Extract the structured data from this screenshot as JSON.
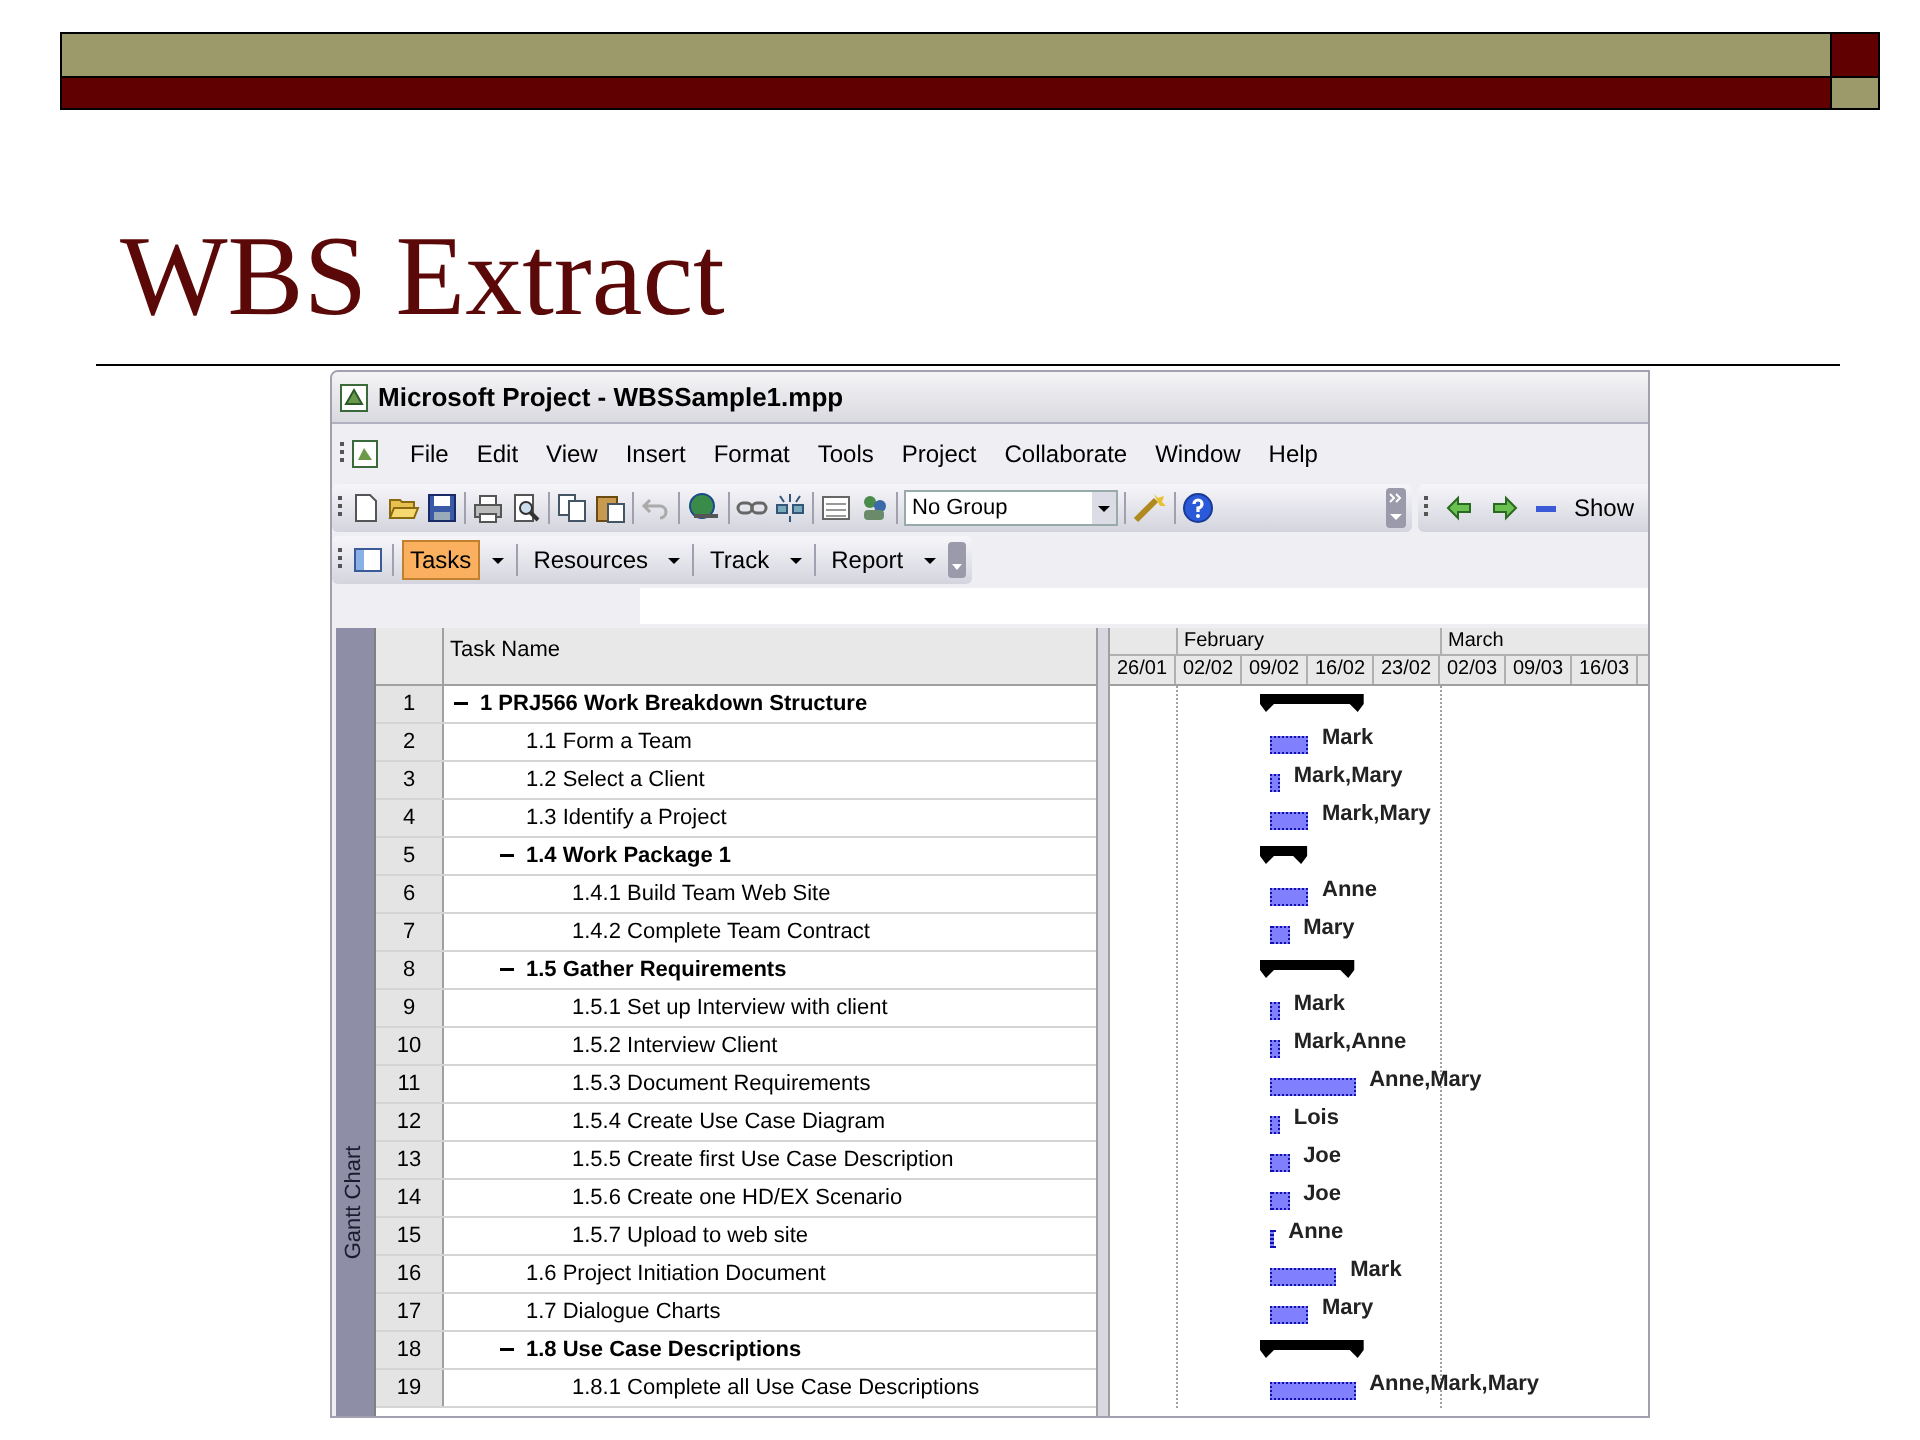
{
  "slide": {
    "title": "WBS Extract"
  },
  "window": {
    "title": "Microsoft Project - WBSSample1.mpp"
  },
  "menu": [
    "File",
    "Edit",
    "View",
    "Insert",
    "Format",
    "Tools",
    "Project",
    "Collaborate",
    "Window",
    "Help"
  ],
  "toolbar": {
    "group_select": "No Group",
    "show_button": "Show"
  },
  "guide_toolbar": [
    {
      "label": "Tasks",
      "selected": true
    },
    {
      "label": "Resources",
      "selected": false
    },
    {
      "label": "Track",
      "selected": false
    },
    {
      "label": "Report",
      "selected": false
    }
  ],
  "view_bar": {
    "label": "Gantt Chart"
  },
  "table": {
    "columns": [
      "Task Name"
    ]
  },
  "gantt": {
    "timescale": [
      {
        "weeks": [
          "26/01"
        ]
      },
      {
        "label": "February",
        "weeks": [
          "02/02",
          "09/02",
          "16/02",
          "23/02"
        ]
      },
      {
        "label": "March",
        "weeks": [
          "02/03",
          "09/03",
          "16/03"
        ]
      }
    ]
  },
  "tasks": [
    {
      "num": "1",
      "name": "1 PRJ566 Work Breakdown Structure",
      "expanded": true,
      "children": [
        {
          "num": "2",
          "name": "1.1 Form a Team",
          "resources": "Mark"
        },
        {
          "num": "3",
          "name": "1.2 Select a Client",
          "resources": "Mark,Mary"
        },
        {
          "num": "4",
          "name": "1.3 Identify a Project",
          "resources": "Mark,Mary"
        },
        {
          "num": "5",
          "name": "1.4 Work Package 1",
          "expanded": true,
          "children": [
            {
              "num": "6",
              "name": "1.4.1 Build Team Web Site",
              "resources": "Anne"
            },
            {
              "num": "7",
              "name": "1.4.2 Complete Team Contract",
              "resources": "Mary"
            }
          ]
        },
        {
          "num": "8",
          "name": "1.5 Gather Requirements",
          "expanded": true,
          "children": [
            {
              "num": "9",
              "name": "1.5.1 Set up Interview with client",
              "resources": "Mark"
            },
            {
              "num": "10",
              "name": "1.5.2 Interview Client",
              "resources": "Mark,Anne"
            },
            {
              "num": "11",
              "name": "1.5.3 Document Requirements",
              "resources": "Anne,Mary"
            },
            {
              "num": "12",
              "name": "1.5.4 Create Use Case Diagram",
              "resources": "Lois"
            },
            {
              "num": "13",
              "name": "1.5.5 Create first Use Case Description",
              "resources": "Joe"
            },
            {
              "num": "14",
              "name": "1.5.6 Create one HD/EX Scenario",
              "resources": "Joe"
            },
            {
              "num": "15",
              "name": "1.5.7 Upload to web site",
              "resources": "Anne"
            }
          ]
        },
        {
          "num": "16",
          "name": "1.6 Project Initiation Document",
          "resources": "Mark"
        },
        {
          "num": "17",
          "name": "1.7 Dialogue Charts",
          "resources": "Mary"
        },
        {
          "num": "18",
          "name": "1.8 Use Case Descriptions",
          "expanded": true,
          "children": [
            {
              "num": "19",
              "name": "1.8.1 Complete all Use Case Descriptions",
              "resources": "Anne,Mark,Mary"
            }
          ]
        }
      ]
    }
  ]
}
